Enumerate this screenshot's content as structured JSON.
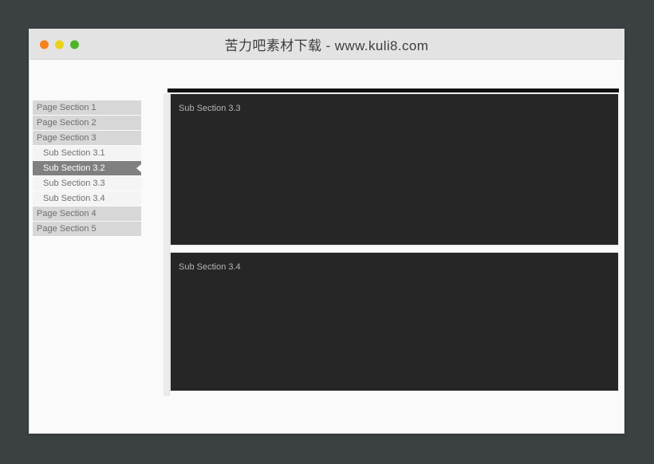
{
  "window": {
    "title": "苦力吧素材下载 - www.kuli8.com",
    "traffic_lights": [
      {
        "name": "close-button",
        "color": "#f58220"
      },
      {
        "name": "minimize-button",
        "color": "#e9d21c"
      },
      {
        "name": "zoom-button",
        "color": "#4fb32a"
      }
    ]
  },
  "sidebar": {
    "items": [
      {
        "label": "Page Section 1",
        "level": "top",
        "active": false
      },
      {
        "label": "Page Section 2",
        "level": "top",
        "active": false
      },
      {
        "label": "Page Section 3",
        "level": "top",
        "active": false
      },
      {
        "label": "Sub Section 3.1",
        "level": "sub",
        "active": false
      },
      {
        "label": "Sub Section 3.2",
        "level": "sub",
        "active": true
      },
      {
        "label": "Sub Section 3.3",
        "level": "sub",
        "active": false
      },
      {
        "label": "Sub Section 3.4",
        "level": "sub",
        "active": false
      },
      {
        "label": "Page Section 4",
        "level": "top",
        "active": false
      },
      {
        "label": "Page Section 5",
        "level": "top",
        "active": false
      }
    ]
  },
  "content": {
    "panels": [
      {
        "title": "Sub Section 3.3"
      },
      {
        "title": "Sub Section 3.4"
      }
    ]
  },
  "colors": {
    "page_background": "#3b4142",
    "window_background": "#fafafa",
    "titlebar": "#e3e3e3",
    "sidebar_top_item": "#d7d7d7",
    "sidebar_sub_item": "#f4f4f4",
    "sidebar_active": "#808080",
    "panel": "#262626"
  }
}
